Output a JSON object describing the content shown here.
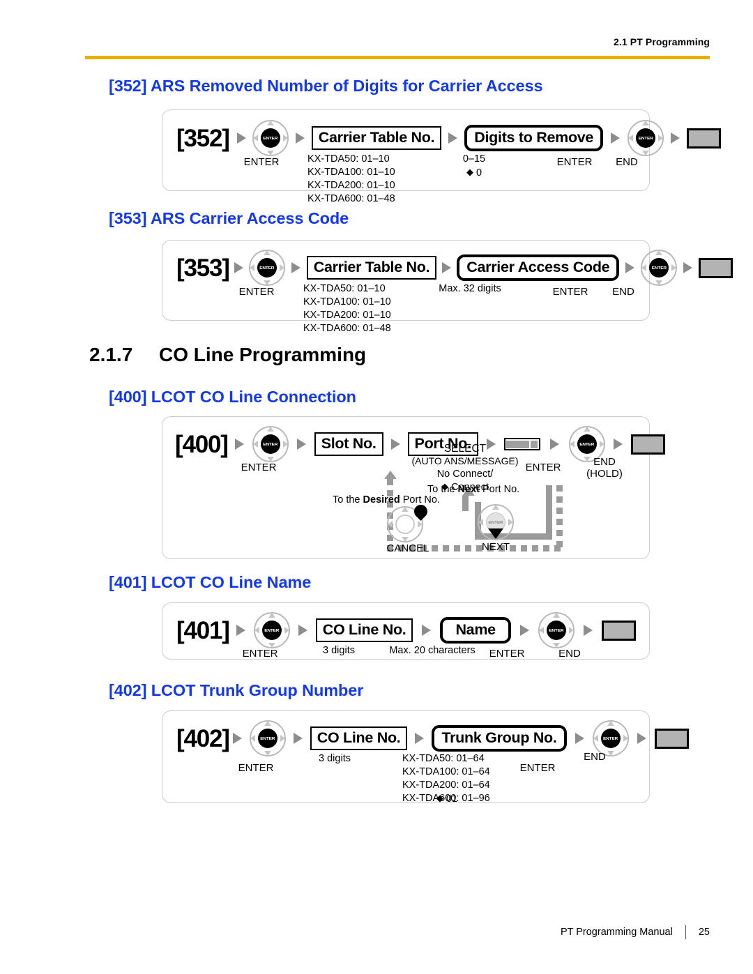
{
  "header": {
    "section_label": "2.1 PT Programming"
  },
  "footer": {
    "manual": "PT Programming Manual",
    "page": "25"
  },
  "enter_caption": "ENTER",
  "end_caption": "END",
  "sections": {
    "s352": {
      "heading": "[352] ARS Removed Number of Digits for Carrier Access",
      "code": "[352]",
      "param_box": "Carrier Table No.",
      "value_box": "Digits to Remove",
      "param_note": "KX-TDA50: 01–10\nKX-TDA100: 01–10\nKX-TDA200: 01–10\nKX-TDA600: 01–48",
      "value_note_range": "0–15",
      "value_note_default": "0"
    },
    "s353": {
      "heading": "[353] ARS Carrier Access Code",
      "code": "[353]",
      "param_box": "Carrier Table No.",
      "value_box": "Carrier Access Code",
      "param_note": "KX-TDA50: 01–10\nKX-TDA100: 01–10\nKX-TDA200: 01–10\nKX-TDA600: 01–48",
      "value_note_range": "Max. 32 digits"
    },
    "s217": {
      "number": "2.1.7",
      "title": "CO Line Programming"
    },
    "s400": {
      "heading": "[400] LCOT CO Line Connection",
      "code": "[400]",
      "param_box_1": "Slot No.",
      "param_box_2": "Port No.",
      "select_caption": "SELECT",
      "select_sub": "(AUTO ANS/MESSAGE)",
      "select_note_1": "No Connect/",
      "select_note_2": "Connect",
      "end_caption_2": "(HOLD)",
      "cancel_caption": "CANCEL",
      "next_caption": "NEXT",
      "loop_desired_pre": "To the ",
      "loop_desired_bold": "Desired",
      "loop_desired_post": " Port No.",
      "loop_next_pre": "To the ",
      "loop_next_bold": "Next",
      "loop_next_post": " Port No."
    },
    "s401": {
      "heading": "[401] LCOT CO Line Name",
      "code": "[401]",
      "param_box": "CO Line No.",
      "value_box": "Name",
      "param_note": "3 digits",
      "value_note_range": "Max. 20 characters"
    },
    "s402": {
      "heading": "[402] LCOT Trunk Group Number",
      "code": "[402]",
      "param_box": "CO Line No.",
      "value_box": "Trunk Group No.",
      "param_note": "3 digits",
      "value_note_range": "KX-TDA50: 01–64\nKX-TDA100: 01–64\nKX-TDA200: 01–64\nKX-TDA600: 01–96",
      "value_note_default": "01"
    }
  },
  "colors": {
    "heading_blue": "#1439e8",
    "header_rule": "#e8b000",
    "frame_border": "#cccccc",
    "arrow_grey": "#8d8d8d",
    "end_fill": "#b3b3b3"
  }
}
